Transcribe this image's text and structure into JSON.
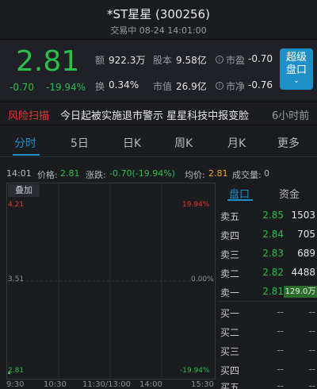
{
  "header": {
    "title": "*ST星星 (300256)",
    "subtitle": "交易中 08-24 14:01:00"
  },
  "quote": {
    "price": "2.81",
    "change": "-0.70",
    "change_pct": "-19.94%",
    "amount_label": "额",
    "amount": "922.3万",
    "share_capital_label": "股本",
    "share_capital": "9.58亿",
    "pe_label": "市盈",
    "pe": "-0.70",
    "turnover_label": "换",
    "turnover": "0.34%",
    "market_cap_label": "市值",
    "market_cap": "26.9亿",
    "pb_label": "市净",
    "pb": "-0.76",
    "advanced_button_line1": "超级",
    "advanced_button_line2": "盘口",
    "advanced_button_chevron": "⌄"
  },
  "ticker": {
    "label": "风险扫描",
    "text": "今日起被实施退市警示 星星科技中报变脸",
    "time": "6小时前"
  },
  "tabs": [
    "分时",
    "5日",
    "日K",
    "周K",
    "月K",
    "更多"
  ],
  "stats": {
    "time": "14:01",
    "price_label": "价格:",
    "price": "2.81",
    "change_label": "涨跌:",
    "change": "-0.70(-19.94%)",
    "avg_label": "均价:",
    "avg": "2.81",
    "volume_label": "成交量:",
    "volume": "0"
  },
  "chart": {
    "overlay_label": "叠加",
    "y_top": "4.21",
    "y_mid": "3.51",
    "y_bottom": "2.81",
    "pct_top": "19.94%",
    "pct_mid": "0.00%",
    "pct_bottom": "-19.94%",
    "x_ticks": [
      "9:30",
      "10:30",
      "11:30/13:00",
      "14:00",
      "15:30"
    ]
  },
  "order_book": {
    "tabs": [
      "盘口",
      "资金"
    ],
    "asks": [
      {
        "label": "卖五",
        "price": "2.85",
        "volume": "1503"
      },
      {
        "label": "卖四",
        "price": "2.84",
        "volume": "705"
      },
      {
        "label": "卖三",
        "price": "2.83",
        "volume": "689"
      },
      {
        "label": "卖二",
        "price": "2.82",
        "volume": "4488"
      },
      {
        "label": "卖一",
        "price": "2.81",
        "volume": "129.0万"
      }
    ],
    "bids": [
      {
        "label": "买一",
        "price": "--",
        "volume": "--"
      },
      {
        "label": "买二",
        "price": "--",
        "volume": "--"
      },
      {
        "label": "买三",
        "price": "--",
        "volume": "--"
      },
      {
        "label": "买四",
        "price": "--",
        "volume": "--"
      },
      {
        "label": "买五",
        "price": "--",
        "volume": "--"
      }
    ]
  },
  "colors": {
    "down": "#2bbf4c",
    "up": "#e2392f",
    "accent": "#1e90c8",
    "avg": "#f5a623"
  }
}
